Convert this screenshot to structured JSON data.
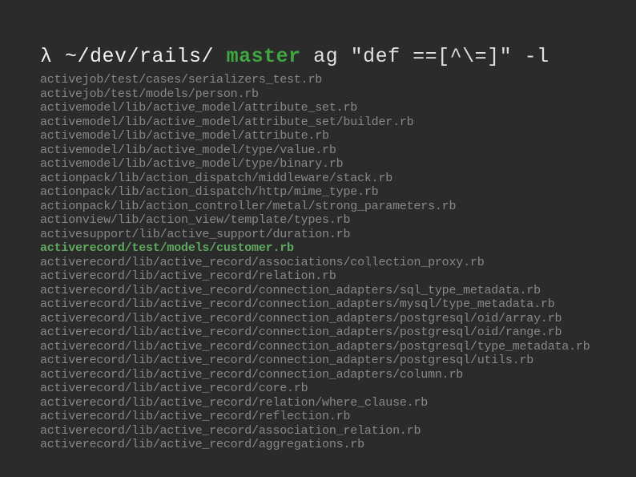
{
  "prompt": {
    "lambda": "λ",
    "path": "~/dev/rails/",
    "branch": "master",
    "command": "ag \"def ==[^\\=]\" -l"
  },
  "output_lines": [
    {
      "text": "activejob/test/cases/serializers_test.rb",
      "hl": false
    },
    {
      "text": "activejob/test/models/person.rb",
      "hl": false
    },
    {
      "text": "activemodel/lib/active_model/attribute_set.rb",
      "hl": false
    },
    {
      "text": "activemodel/lib/active_model/attribute_set/builder.rb",
      "hl": false
    },
    {
      "text": "activemodel/lib/active_model/attribute.rb",
      "hl": false
    },
    {
      "text": "activemodel/lib/active_model/type/value.rb",
      "hl": false
    },
    {
      "text": "activemodel/lib/active_model/type/binary.rb",
      "hl": false
    },
    {
      "text": "actionpack/lib/action_dispatch/middleware/stack.rb",
      "hl": false
    },
    {
      "text": "actionpack/lib/action_dispatch/http/mime_type.rb",
      "hl": false
    },
    {
      "text": "actionpack/lib/action_controller/metal/strong_parameters.rb",
      "hl": false
    },
    {
      "text": "actionview/lib/action_view/template/types.rb",
      "hl": false
    },
    {
      "text": "activesupport/lib/active_support/duration.rb",
      "hl": false
    },
    {
      "text": "activerecord/test/models/customer.rb",
      "hl": true
    },
    {
      "text": "activerecord/lib/active_record/associations/collection_proxy.rb",
      "hl": false
    },
    {
      "text": "activerecord/lib/active_record/relation.rb",
      "hl": false
    },
    {
      "text": "activerecord/lib/active_record/connection_adapters/sql_type_metadata.rb",
      "hl": false
    },
    {
      "text": "activerecord/lib/active_record/connection_adapters/mysql/type_metadata.rb",
      "hl": false
    },
    {
      "text": "activerecord/lib/active_record/connection_adapters/postgresql/oid/array.rb",
      "hl": false
    },
    {
      "text": "activerecord/lib/active_record/connection_adapters/postgresql/oid/range.rb",
      "hl": false
    },
    {
      "text": "activerecord/lib/active_record/connection_adapters/postgresql/type_metadata.rb",
      "hl": false
    },
    {
      "text": "activerecord/lib/active_record/connection_adapters/postgresql/utils.rb",
      "hl": false
    },
    {
      "text": "activerecord/lib/active_record/connection_adapters/column.rb",
      "hl": false
    },
    {
      "text": "activerecord/lib/active_record/core.rb",
      "hl": false
    },
    {
      "text": "activerecord/lib/active_record/relation/where_clause.rb",
      "hl": false
    },
    {
      "text": "activerecord/lib/active_record/reflection.rb",
      "hl": false
    },
    {
      "text": "activerecord/lib/active_record/association_relation.rb",
      "hl": false
    },
    {
      "text": "activerecord/lib/active_record/aggregations.rb",
      "hl": false
    }
  ]
}
